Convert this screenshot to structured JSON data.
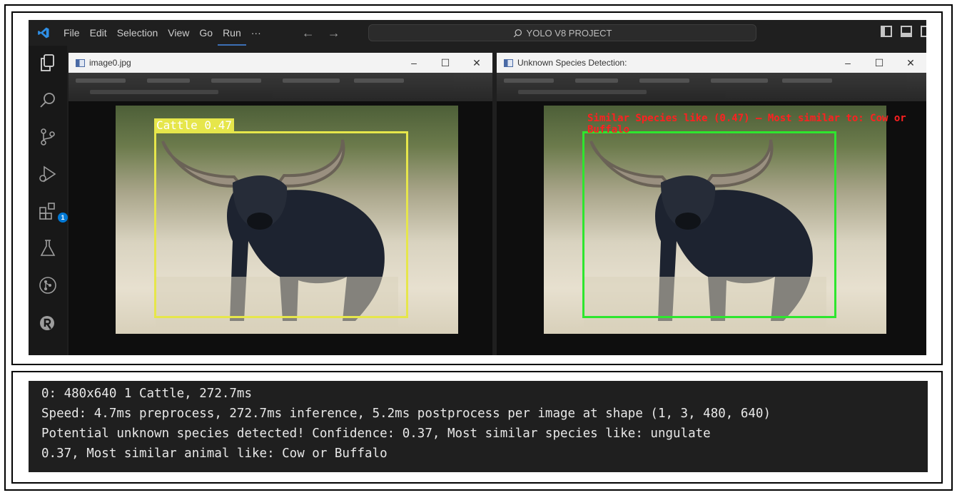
{
  "menu": {
    "items": [
      "File",
      "Edit",
      "Selection",
      "View",
      "Go",
      "Run",
      "···"
    ]
  },
  "search": {
    "label": "YOLO V8 PROJECT"
  },
  "activity_bar": {
    "icons": [
      "explorer-icon",
      "search-icon",
      "source-control-icon",
      "run-debug-icon",
      "extensions-icon",
      "testing-icon",
      "git-graph-icon",
      "extension-r-icon"
    ],
    "extensions_badge": "1"
  },
  "window_left": {
    "title": "image0.jpg",
    "detection_label": "Cattle 0.47",
    "box_color": "#e6e64b"
  },
  "window_right": {
    "title": "Unknown Species Detection:",
    "detection_label": "Similar Species like (0.47) – Most similar to: Cow or Buffalo",
    "box_color": "#2ee62e",
    "label_color": "#ff2020"
  },
  "terminal": {
    "lines": [
      "0: 480x640 1 Cattle, 272.7ms",
      "Speed: 4.7ms preprocess, 272.7ms inference, 5.2ms postprocess per image at shape (1, 3, 480, 640)",
      "Potential unknown species detected! Confidence: 0.37, Most similar species like: ungulate",
      "0.37, Most similar animal like: Cow or Buffalo"
    ]
  }
}
